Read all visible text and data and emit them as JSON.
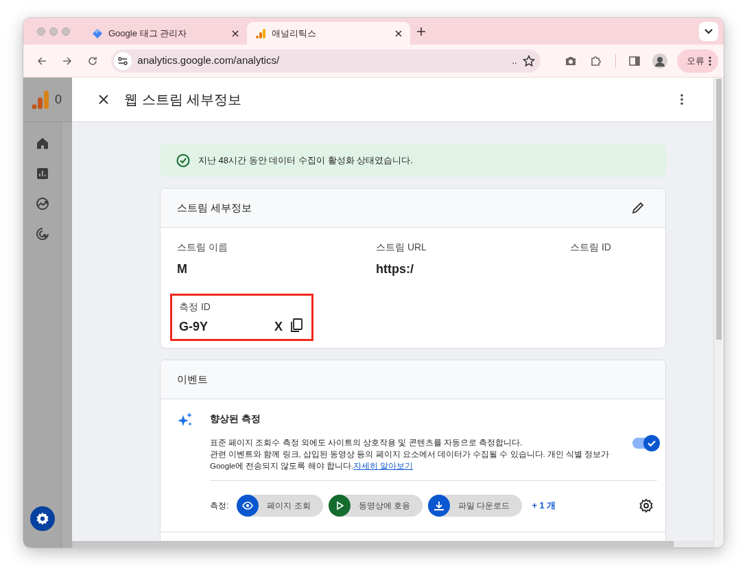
{
  "browser": {
    "tabs": [
      {
        "title": "Google 태그 관리자",
        "kind": "tagmanager",
        "selected": false
      },
      {
        "title": "애널리틱스",
        "kind": "analytics",
        "selected": true
      }
    ],
    "address": {
      "url": "analytics.google.com/analytics/",
      "tail": ".."
    },
    "profile_button": "오류"
  },
  "app": {
    "title_fragment": "0",
    "nav": [
      {
        "kind": "home",
        "selected": false
      },
      {
        "kind": "reports",
        "selected": false
      },
      {
        "kind": "explore",
        "selected": false
      },
      {
        "kind": "advertising",
        "selected": false
      },
      {
        "kind": "admin",
        "selected": true
      }
    ]
  },
  "panel": {
    "title": "웹 스트림 세부정보",
    "banner": "지난 48시간 동안 데이터 수집이 활성화 상태였습니다.",
    "stream_details": {
      "title": "스트림 세부정보",
      "fields": [
        {
          "label": "스트림 이름",
          "value": "M"
        },
        {
          "label": "스트림 URL",
          "value": "https:/"
        },
        {
          "label": "스트림 ID"
        }
      ],
      "measurement_id": {
        "label": "측정 ID",
        "value": "G-9Y",
        "value_end": "X",
        "highlighted": true
      }
    },
    "events": {
      "title": "이벤트",
      "enhanced": {
        "title": "향상된 측정",
        "on": true,
        "description": "표준 페이지 조회수 측정 외에도 사이트의 상호작용 및 콘텐츠를 자동으로 측정합니다.",
        "note": "관련 이벤트와 함께 링크, 삽입된 동영상 등의 페이지 요소에서 데이터가 수집될 수 있습니다. 개인 식별 정보가 Google에 전송되지 않도록 해야 합니다.",
        "link": "자세히 알아보기",
        "measuring_label": "측정:",
        "chips": [
          {
            "label": "페이지 조회",
            "kind": "eye",
            "color": "#0b57d0"
          },
          {
            "label": "동영상에 호응",
            "kind": "play",
            "color": "#146c2e"
          },
          {
            "label": "파일 다운로드",
            "kind": "download",
            "color": "#0b57d0"
          }
        ],
        "more": "+ 1 개"
      }
    }
  }
}
